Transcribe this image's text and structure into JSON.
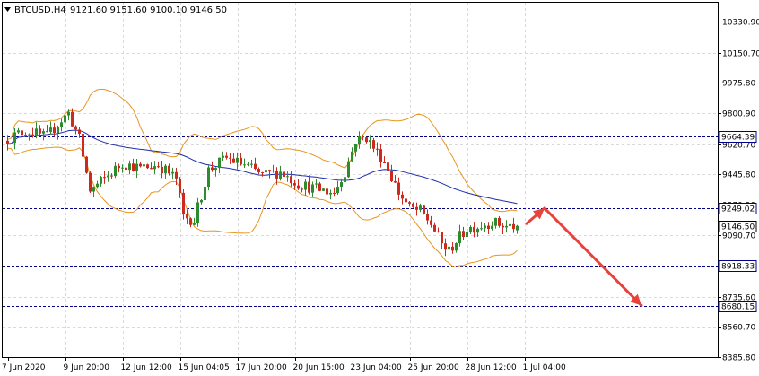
{
  "header": {
    "symbol_tf": "BTCUSD,H4",
    "ohlc": "9121.60 9151.60 9100.10 9146.50"
  },
  "colors": {
    "background": "#ffffff",
    "grid": "#d9d9d9",
    "bull_candle": "#2e8b2e",
    "bear_candle": "#cc2a1e",
    "bollinger": "#e8951e",
    "moving_average": "#1f2fa8",
    "level_line": "#00008b",
    "arrow": "#e8423a",
    "axis": "#000000"
  },
  "chart_data": {
    "type": "candlestick",
    "title": "BTCUSD,H4",
    "ohlc_last": {
      "open": 9121.6,
      "high": 9151.6,
      "low": 9100.1,
      "close": 9146.5
    },
    "ylim": [
      8385.8,
      10440.0
    ],
    "grid": true,
    "y_ticks": [
      "10330.90",
      "10150.70",
      "9975.80",
      "9800.90",
      "9620.70",
      "9445.80",
      "9270.90",
      "9090.70",
      "8735.60",
      "8560.70",
      "8385.80"
    ],
    "x_ticks": [
      "7 Jun 2020",
      "9 Jun 20:00",
      "12 Jun 12:00",
      "15 Jun 04:05",
      "17 Jun 20:00",
      "20 Jun 15:00",
      "23 Jun 04:00",
      "25 Jun 20:00",
      "28 Jun 12:00",
      "1 Jul 04:00"
    ],
    "horizontal_levels": [
      {
        "value": 9664.39,
        "label": "9664.39"
      },
      {
        "value": 9249.02,
        "label": "9249.02"
      },
      {
        "value": 8918.33,
        "label": "8918.33"
      },
      {
        "value": 8680.15,
        "label": "8680.15"
      }
    ],
    "current_price": {
      "value": 9146.5,
      "label": "9146.50"
    },
    "candle_count": 143,
    "price_path": [
      [
        0,
        9640
      ],
      [
        6,
        9700
      ],
      [
        12,
        9660
      ],
      [
        15,
        9740
      ],
      [
        18,
        9800
      ],
      [
        21,
        9650
      ],
      [
        24,
        9350
      ],
      [
        28,
        9420
      ],
      [
        33,
        9510
      ],
      [
        38,
        9480
      ],
      [
        43,
        9500
      ],
      [
        48,
        9420
      ],
      [
        50,
        9200
      ],
      [
        53,
        9180
      ],
      [
        57,
        9470
      ],
      [
        62,
        9540
      ],
      [
        67,
        9500
      ],
      [
        72,
        9440
      ],
      [
        77,
        9460
      ],
      [
        82,
        9390
      ],
      [
        87,
        9360
      ],
      [
        92,
        9340
      ],
      [
        95,
        9460
      ],
      [
        98,
        9640
      ],
      [
        101,
        9660
      ],
      [
        103,
        9600
      ],
      [
        106,
        9520
      ],
      [
        110,
        9340
      ],
      [
        113,
        9250
      ],
      [
        116,
        9230
      ],
      [
        119,
        9160
      ],
      [
        122,
        9040
      ],
      [
        124,
        9000
      ],
      [
        126,
        9060
      ],
      [
        129,
        9130
      ],
      [
        133,
        9150
      ],
      [
        136,
        9170
      ],
      [
        140,
        9140
      ],
      [
        142,
        9146
      ]
    ],
    "annotation_arrows": [
      {
        "from": {
          "x_index": 145,
          "y": 9160
        },
        "to": {
          "x_index": 150,
          "y": 9249
        }
      },
      {
        "from": {
          "x_index": 150,
          "y": 9249
        },
        "to": {
          "x_index": 177,
          "y": 8685
        }
      }
    ],
    "indicators": [
      {
        "type": "bollinger_bands",
        "color": "orange"
      },
      {
        "type": "moving_average",
        "color": "blue"
      }
    ]
  }
}
